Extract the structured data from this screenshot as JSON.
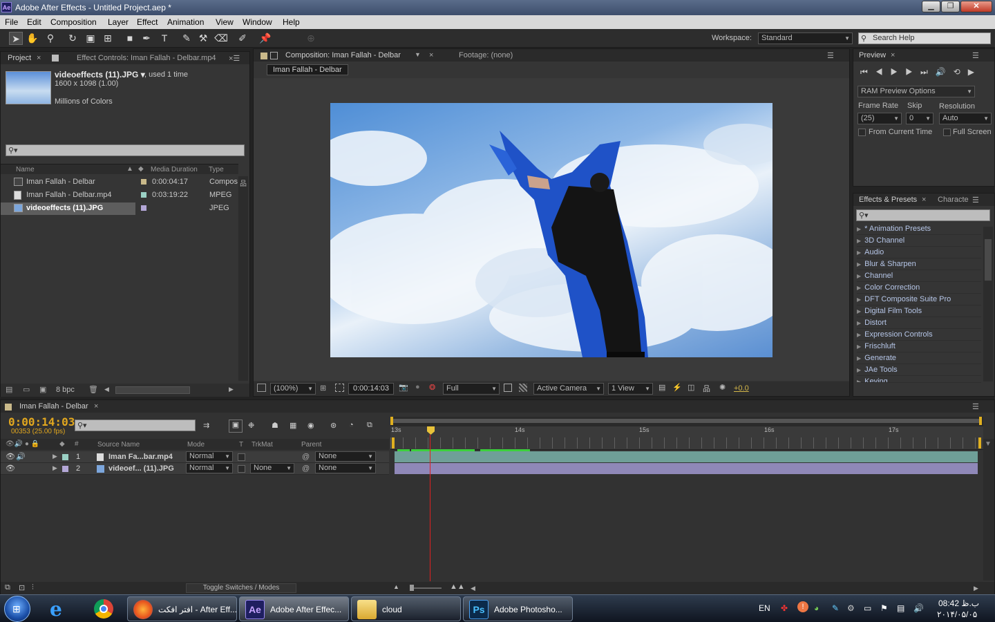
{
  "window": {
    "title": "Adobe After Effects - Untitled Project.aep *",
    "minimize": "▁",
    "maximize": "❐",
    "close": "✕"
  },
  "menu": [
    "File",
    "Edit",
    "Composition",
    "Layer",
    "Effect",
    "Animation",
    "View",
    "Window",
    "Help"
  ],
  "toolbar": {
    "workspace_label": "Workspace:",
    "workspace_value": "Standard",
    "search_placeholder": "Search Help"
  },
  "project": {
    "tab_project": "Project",
    "tab_effect_controls": "Effect Controls: Iman Fallah - Delbar.mp4",
    "selected_name": "videoeffects (11).JPG ▾",
    "used": ", used 1 time",
    "dimensions": "1600 x 1098 (1.00)",
    "colors": "Millions of Colors",
    "col_name": "Name",
    "col_duration": "Media Duration",
    "col_type": "Type",
    "items": [
      {
        "name": "Iman Fallah - Delbar",
        "duration": "0:00:04:17",
        "type": "Compos",
        "color": "#c9b98a"
      },
      {
        "name": "Iman Fallah - Delbar.mp4",
        "duration": "0:03:19:22",
        "type": "MPEG",
        "color": "#9ad0c4"
      },
      {
        "name": "videoeffects (11).JPG",
        "duration": "",
        "type": "JPEG",
        "color": "#b3a7d6"
      }
    ],
    "bpc": "8 bpc"
  },
  "composition": {
    "tab": "Composition: Iman Fallah - Delbar",
    "footage_tab": "Footage: (none)",
    "subtab": "Iman Fallah - Delbar",
    "zoom": "(100%)",
    "timecode": "0:00:14:03",
    "resolution": "Full",
    "camera": "Active Camera",
    "view": "1 View",
    "exposure": "+0.0"
  },
  "preview": {
    "tab": "Preview",
    "ram_options": "RAM Preview Options",
    "frame_rate_label": "Frame Rate",
    "skip_label": "Skip",
    "resolution_label": "Resolution",
    "frame_rate": "(25)",
    "skip": "0",
    "resolution": "Auto",
    "from_current": "From Current Time",
    "full_screen": "Full Screen"
  },
  "effects": {
    "tab": "Effects & Presets",
    "tab2": "Characte",
    "items": [
      "* Animation Presets",
      "3D Channel",
      "Audio",
      "Blur & Sharpen",
      "Channel",
      "Color Correction",
      "DFT Composite Suite Pro",
      "Digital Film Tools",
      "Distort",
      "Expression Controls",
      "Frischluft",
      "Generate",
      "JAe Tools",
      "Keying"
    ]
  },
  "timeline": {
    "tab": "Iman Fallah - Delbar",
    "timecode": "0:00:14:03",
    "frames": "00353 (25.00 fps)",
    "col_num": "#",
    "col_source": "Source Name",
    "col_mode": "Mode",
    "col_t": "T",
    "col_trkmat": "TrkMat",
    "col_parent": "Parent",
    "ruler": [
      "13s",
      "14s",
      "15s",
      "16s",
      "17s"
    ],
    "layers": [
      {
        "num": "1",
        "name": "Iman Fa...bar.mp4",
        "mode": "Normal",
        "trkmat": "",
        "parent": "None",
        "color": "#9ad0c4"
      },
      {
        "num": "2",
        "name": "videoef... (11).JPG",
        "mode": "Normal",
        "trkmat": "None",
        "parent": "None",
        "color": "#b3a7d6"
      }
    ],
    "toggle": "Toggle Switches / Modes"
  },
  "taskbar": {
    "items": [
      {
        "label": "افتر افکت - After Eff..."
      },
      {
        "label": "Adobe After Effec..."
      },
      {
        "label": "cloud"
      },
      {
        "label": "Adobe Photosho..."
      }
    ],
    "lang": "EN",
    "time": "08:42 ب.ظ",
    "date": "۲۰۱۴/۰۵/۰۵"
  }
}
